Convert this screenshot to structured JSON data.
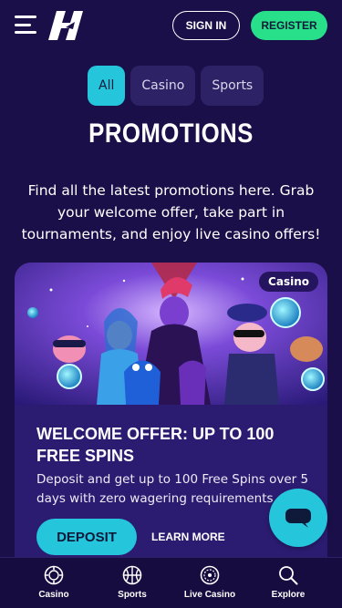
{
  "header": {
    "signin_label": "SIGN IN",
    "register_label": "REGISTER"
  },
  "filters": [
    {
      "label": "All",
      "active": true
    },
    {
      "label": "Casino",
      "active": false
    },
    {
      "label": "Sports",
      "active": false
    }
  ],
  "page": {
    "title": "PROMOTIONS",
    "intro": "Find all the latest promotions here. Grab your welcome offer, take part in tournaments, and enjoy live casino offers!"
  },
  "promo": {
    "badge": "Casino",
    "title": "WELCOME OFFER: UP TO 100 FREE SPINS",
    "description": "Deposit and get up to 100 Free Spins over 5 days with zero wagering requirements",
    "deposit_label": "DEPOSIT",
    "learn_more_label": "LEARN MORE"
  },
  "bottom_nav": [
    {
      "label": "Casino",
      "icon": "casino-chip-icon"
    },
    {
      "label": "Sports",
      "icon": "basketball-icon"
    },
    {
      "label": "Live Casino",
      "icon": "roulette-icon"
    },
    {
      "label": "Explore",
      "icon": "search-icon"
    }
  ],
  "colors": {
    "background": "#1b0f4a",
    "accent_cyan": "#25c6dc",
    "register_green": "#28e08a",
    "card": "#2b1c72"
  }
}
